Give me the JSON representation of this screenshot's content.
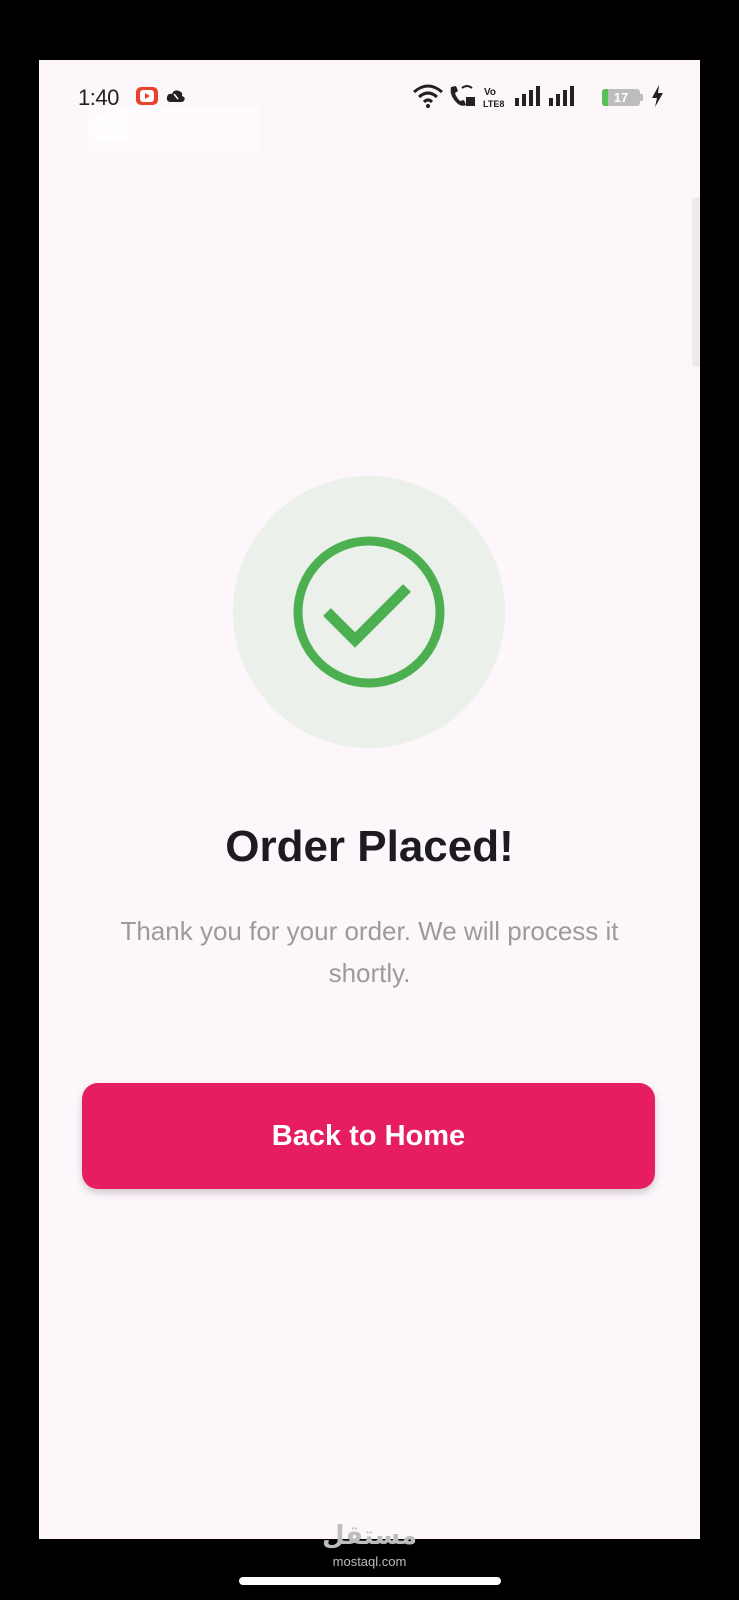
{
  "status_bar": {
    "time": "1:40",
    "battery_level": "17",
    "battery_fraction": 0.17,
    "icons": [
      "youtube-notification-icon",
      "cloud-icon",
      "wifi-icon",
      "wifi-calling-icon",
      "volte-icon",
      "signal-icon",
      "signal-icon",
      "battery-icon",
      "charging-icon"
    ]
  },
  "overlay": {
    "icon": "capcut-icon"
  },
  "success": {
    "icon": "check-circle-icon",
    "title": "Order Placed!",
    "message": "Thank you for your order. We will process it shortly.",
    "button_label": "Back to Home"
  },
  "watermark": {
    "logo_text": "مستقل",
    "url": "mostaql.com"
  },
  "colors": {
    "accent": "#e61e61",
    "success": "#4caf50",
    "success_bg": "#ebf0ea",
    "background": "#fdf6fb"
  }
}
